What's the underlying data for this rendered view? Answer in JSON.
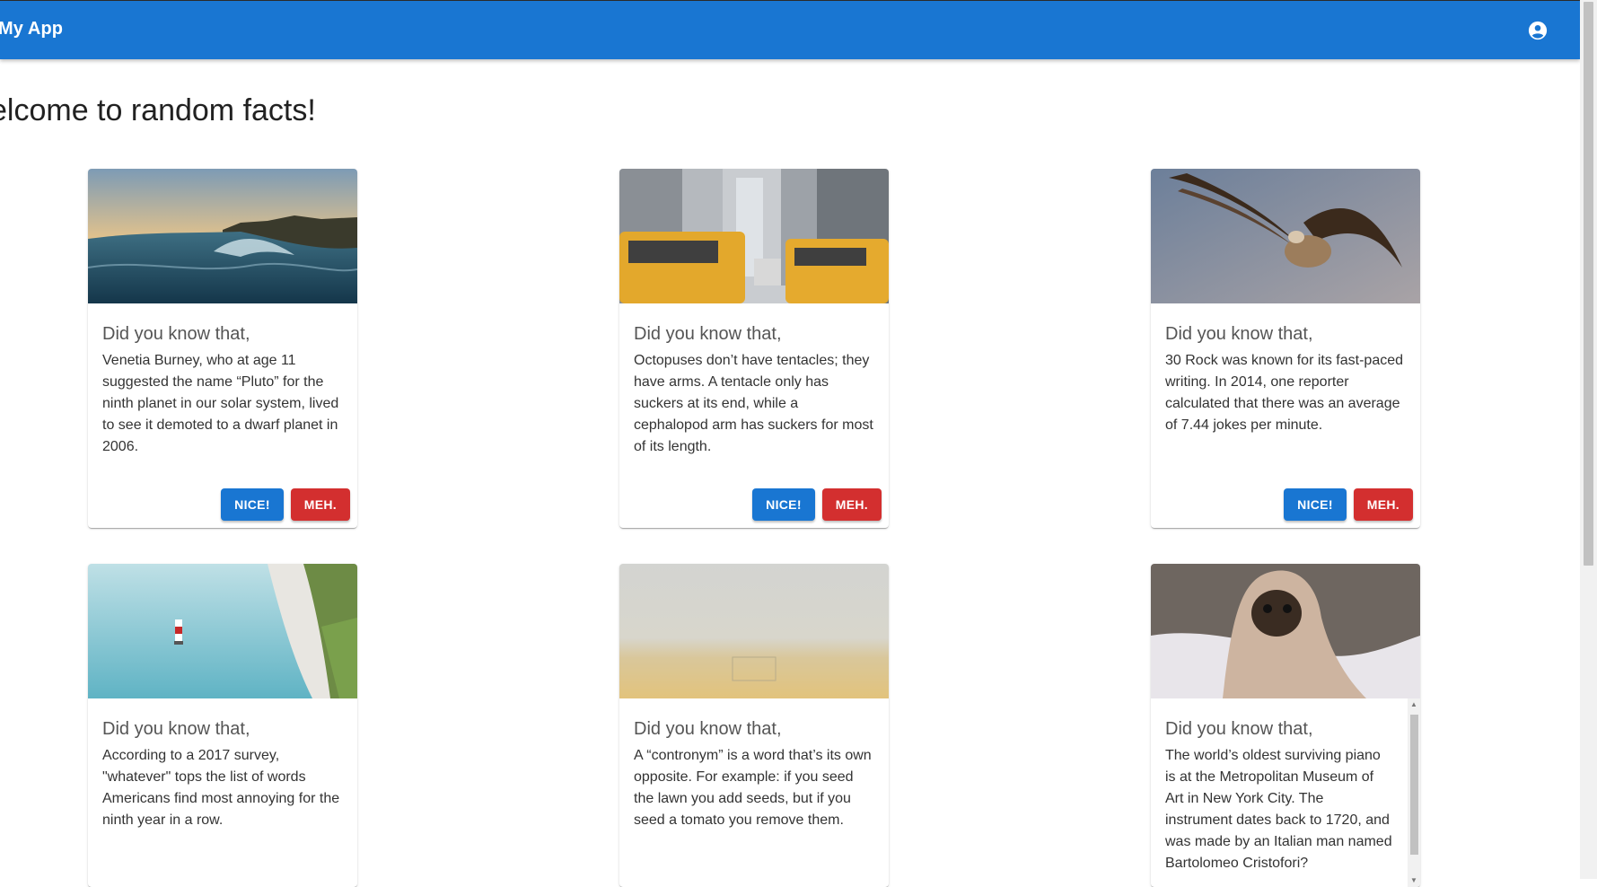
{
  "appbar": {
    "title": "My App",
    "account_icon": "account-circle-icon",
    "color": "#1976d2"
  },
  "heading": "elcome to random facts!",
  "buttons": {
    "nice": "NICE!",
    "meh": "MEH.",
    "nice_color": "#1976d2",
    "meh_color": "#d32f2f"
  },
  "cards": [
    {
      "image": "ocean-wave-photo",
      "title": "Did you know that,",
      "text": "Venetia Burney, who at age 11 suggested the name “Pluto” for the ninth planet in our solar system, lived to see it demoted to a dwarf planet in 2006."
    },
    {
      "image": "taxi-city-street-photo",
      "title": "Did you know that,",
      "text": "Octopuses don’t have tentacles; they have arms. A tentacle only has suckers at its end, while a cephalopod arm has suckers for most of its length."
    },
    {
      "image": "vulture-flying-photo",
      "title": "Did you know that,",
      "text": "30 Rock was known for its fast-paced writing. In 2014, one reporter calculated that there was an average of 7.44 jokes per minute."
    },
    {
      "image": "lighthouse-cliff-photo",
      "title": "Did you know that,",
      "text": "According to a 2017 survey, \"whatever\" tops the list of words Americans find most annoying for the ninth year in a row."
    },
    {
      "image": "foggy-beach-photo",
      "title": "Did you know that,",
      "text": "A “contronym” is a word that’s its own opposite. For example: if you seed the lawn you add seeds, but if you seed a tomato you remove them."
    },
    {
      "image": "pug-blanket-photo",
      "title": "Did you know that,",
      "text": "The world’s oldest surviving piano is at the Metropolitan Museum of Art in New York City. The instrument dates back to 1720, and was made by an Italian man named Bartolomeo Cristofori?"
    }
  ]
}
